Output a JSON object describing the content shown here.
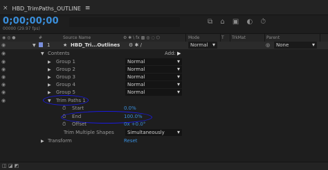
{
  "tab": {
    "close": "×",
    "title": "HBD_TrimPaths_OUTLINE",
    "menu": "≡"
  },
  "timecode": "0;00;00;00",
  "fps": "00000 (29.97 fps)",
  "toolbar_icons": "⧉ ⌂ ▣ ◐ ⏱",
  "headers": {
    "num": "#",
    "source_name": "Source Name",
    "switches": "⚙ ✱ \\ fx ▩ ◎ ◌ ⬡",
    "mode": "Mode",
    "t": "T",
    "trkmat": "TrkMat",
    "parent": "Parent"
  },
  "layer": {
    "number": "1",
    "star": "★",
    "name": "HBD_Tri...Outlines",
    "switches": "⚙ ✱ /",
    "mode": "Normal",
    "parent_icon": "◎",
    "parent": "None"
  },
  "contents": {
    "label": "Contents",
    "add": "Add:"
  },
  "groups": [
    {
      "label": "Group 1",
      "mode": "Normal"
    },
    {
      "label": "Group 2",
      "mode": "Normal"
    },
    {
      "label": "Group 3",
      "mode": "Normal"
    },
    {
      "label": "Group 4",
      "mode": "Normal"
    },
    {
      "label": "Group 5",
      "mode": "Normal"
    }
  ],
  "trim_paths": {
    "label": "Trim Paths 1",
    "start_label": "Start",
    "start_value": "0.0%",
    "end_label": "End",
    "end_value": "100.0%",
    "offset_label": "Offset",
    "offset_value": "0x +0.0°",
    "multiple_label": "Trim Multiple Shapes",
    "multiple_value": "Simultaneously"
  },
  "transform": {
    "label": "Transform",
    "reset": "Reset"
  },
  "icons": {
    "eye": "eye-icon",
    "triangle_open": "triangle-down-icon",
    "triangle_closed": "triangle-right-icon",
    "stopwatch": "stopwatch-icon"
  },
  "colors": {
    "accent_blue": "#3a8fdc",
    "annotation_circle": "#1a1ae0",
    "layer_label": "#7a8fdc"
  }
}
